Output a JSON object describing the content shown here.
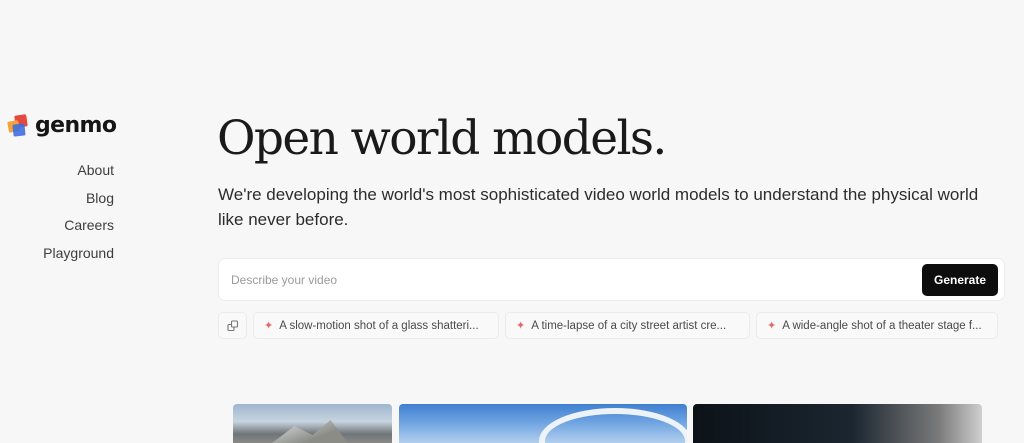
{
  "brand": {
    "name": "genmo"
  },
  "nav": {
    "items": [
      {
        "label": "About"
      },
      {
        "label": "Blog"
      },
      {
        "label": "Careers"
      },
      {
        "label": "Playground"
      }
    ]
  },
  "hero": {
    "headline": "Open world models.",
    "subtitle": "We're developing the world's most sophisticated video world models to understand the physical world like never before."
  },
  "prompt": {
    "placeholder": "Describe your video",
    "value": "",
    "generate_label": "Generate"
  },
  "suggestions": [
    {
      "text": "A slow-motion shot of a glass shatteri..."
    },
    {
      "text": "A time-lapse of a city street artist cre..."
    },
    {
      "text": "A wide-angle shot of a theater stage f..."
    }
  ],
  "icons": {
    "logo": "genmo-logo-icon",
    "shuffle": "shuffle-icon",
    "sparkle": "sparkle-icon"
  },
  "colors": {
    "background": "#f7f7f7",
    "button": "#0d0d0d",
    "sparkle": "#e06a6a"
  }
}
